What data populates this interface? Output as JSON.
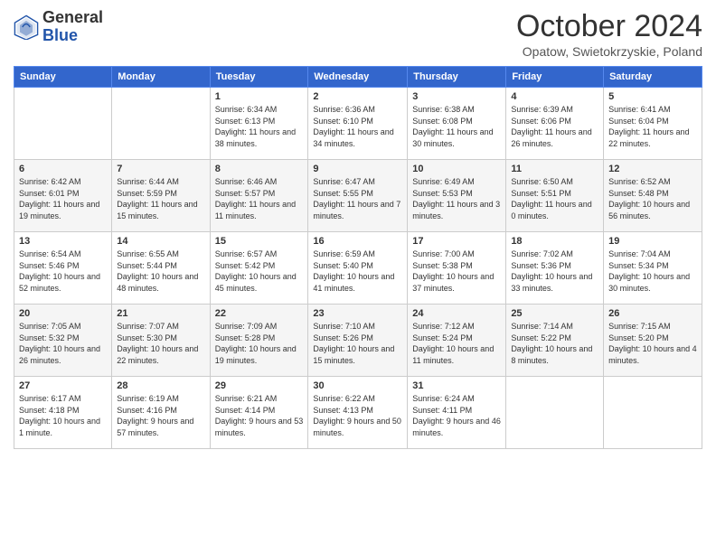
{
  "header": {
    "logo_general": "General",
    "logo_blue": "Blue",
    "month_title": "October 2024",
    "subtitle": "Opatow, Swietokrzyskie, Poland"
  },
  "days_of_week": [
    "Sunday",
    "Monday",
    "Tuesday",
    "Wednesday",
    "Thursday",
    "Friday",
    "Saturday"
  ],
  "weeks": [
    [
      {
        "day": "",
        "info": ""
      },
      {
        "day": "",
        "info": ""
      },
      {
        "day": "1",
        "info": "Sunrise: 6:34 AM\nSunset: 6:13 PM\nDaylight: 11 hours and 38 minutes."
      },
      {
        "day": "2",
        "info": "Sunrise: 6:36 AM\nSunset: 6:10 PM\nDaylight: 11 hours and 34 minutes."
      },
      {
        "day": "3",
        "info": "Sunrise: 6:38 AM\nSunset: 6:08 PM\nDaylight: 11 hours and 30 minutes."
      },
      {
        "day": "4",
        "info": "Sunrise: 6:39 AM\nSunset: 6:06 PM\nDaylight: 11 hours and 26 minutes."
      },
      {
        "day": "5",
        "info": "Sunrise: 6:41 AM\nSunset: 6:04 PM\nDaylight: 11 hours and 22 minutes."
      }
    ],
    [
      {
        "day": "6",
        "info": "Sunrise: 6:42 AM\nSunset: 6:01 PM\nDaylight: 11 hours and 19 minutes."
      },
      {
        "day": "7",
        "info": "Sunrise: 6:44 AM\nSunset: 5:59 PM\nDaylight: 11 hours and 15 minutes."
      },
      {
        "day": "8",
        "info": "Sunrise: 6:46 AM\nSunset: 5:57 PM\nDaylight: 11 hours and 11 minutes."
      },
      {
        "day": "9",
        "info": "Sunrise: 6:47 AM\nSunset: 5:55 PM\nDaylight: 11 hours and 7 minutes."
      },
      {
        "day": "10",
        "info": "Sunrise: 6:49 AM\nSunset: 5:53 PM\nDaylight: 11 hours and 3 minutes."
      },
      {
        "day": "11",
        "info": "Sunrise: 6:50 AM\nSunset: 5:51 PM\nDaylight: 11 hours and 0 minutes."
      },
      {
        "day": "12",
        "info": "Sunrise: 6:52 AM\nSunset: 5:48 PM\nDaylight: 10 hours and 56 minutes."
      }
    ],
    [
      {
        "day": "13",
        "info": "Sunrise: 6:54 AM\nSunset: 5:46 PM\nDaylight: 10 hours and 52 minutes."
      },
      {
        "day": "14",
        "info": "Sunrise: 6:55 AM\nSunset: 5:44 PM\nDaylight: 10 hours and 48 minutes."
      },
      {
        "day": "15",
        "info": "Sunrise: 6:57 AM\nSunset: 5:42 PM\nDaylight: 10 hours and 45 minutes."
      },
      {
        "day": "16",
        "info": "Sunrise: 6:59 AM\nSunset: 5:40 PM\nDaylight: 10 hours and 41 minutes."
      },
      {
        "day": "17",
        "info": "Sunrise: 7:00 AM\nSunset: 5:38 PM\nDaylight: 10 hours and 37 minutes."
      },
      {
        "day": "18",
        "info": "Sunrise: 7:02 AM\nSunset: 5:36 PM\nDaylight: 10 hours and 33 minutes."
      },
      {
        "day": "19",
        "info": "Sunrise: 7:04 AM\nSunset: 5:34 PM\nDaylight: 10 hours and 30 minutes."
      }
    ],
    [
      {
        "day": "20",
        "info": "Sunrise: 7:05 AM\nSunset: 5:32 PM\nDaylight: 10 hours and 26 minutes."
      },
      {
        "day": "21",
        "info": "Sunrise: 7:07 AM\nSunset: 5:30 PM\nDaylight: 10 hours and 22 minutes."
      },
      {
        "day": "22",
        "info": "Sunrise: 7:09 AM\nSunset: 5:28 PM\nDaylight: 10 hours and 19 minutes."
      },
      {
        "day": "23",
        "info": "Sunrise: 7:10 AM\nSunset: 5:26 PM\nDaylight: 10 hours and 15 minutes."
      },
      {
        "day": "24",
        "info": "Sunrise: 7:12 AM\nSunset: 5:24 PM\nDaylight: 10 hours and 11 minutes."
      },
      {
        "day": "25",
        "info": "Sunrise: 7:14 AM\nSunset: 5:22 PM\nDaylight: 10 hours and 8 minutes."
      },
      {
        "day": "26",
        "info": "Sunrise: 7:15 AM\nSunset: 5:20 PM\nDaylight: 10 hours and 4 minutes."
      }
    ],
    [
      {
        "day": "27",
        "info": "Sunrise: 6:17 AM\nSunset: 4:18 PM\nDaylight: 10 hours and 1 minute."
      },
      {
        "day": "28",
        "info": "Sunrise: 6:19 AM\nSunset: 4:16 PM\nDaylight: 9 hours and 57 minutes."
      },
      {
        "day": "29",
        "info": "Sunrise: 6:21 AM\nSunset: 4:14 PM\nDaylight: 9 hours and 53 minutes."
      },
      {
        "day": "30",
        "info": "Sunrise: 6:22 AM\nSunset: 4:13 PM\nDaylight: 9 hours and 50 minutes."
      },
      {
        "day": "31",
        "info": "Sunrise: 6:24 AM\nSunset: 4:11 PM\nDaylight: 9 hours and 46 minutes."
      },
      {
        "day": "",
        "info": ""
      },
      {
        "day": "",
        "info": ""
      }
    ]
  ]
}
